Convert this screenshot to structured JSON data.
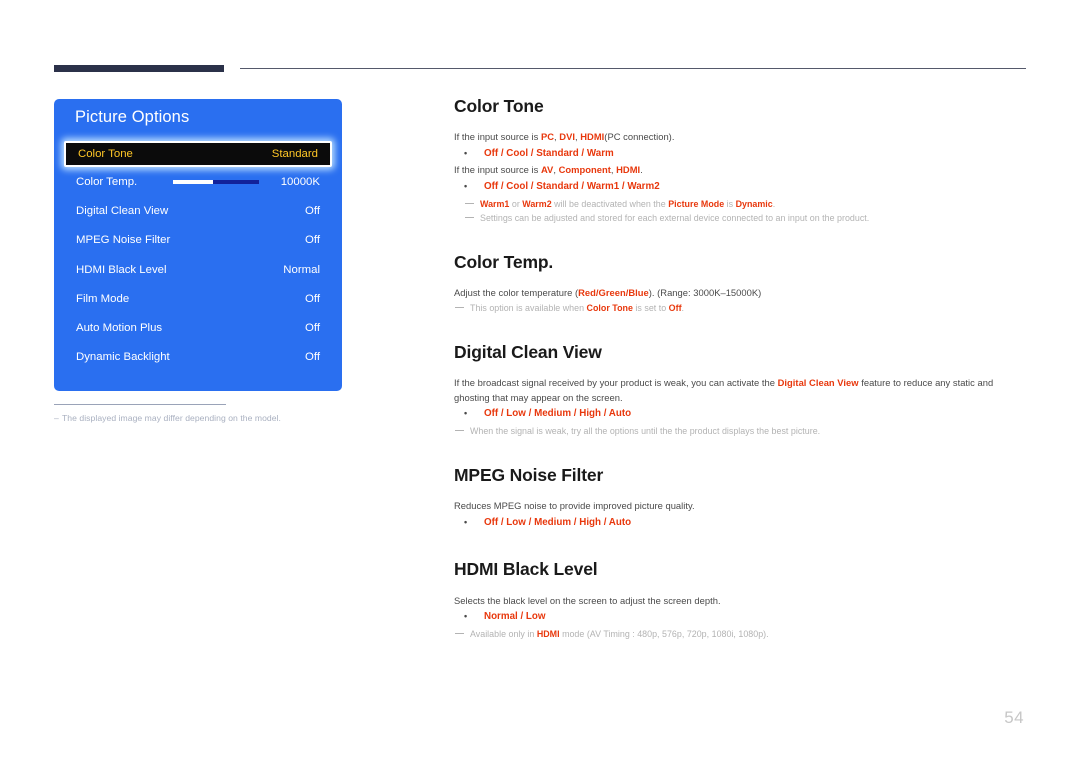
{
  "page": {
    "number": "54"
  },
  "osd": {
    "title": "Picture Options",
    "rows": [
      {
        "label": "Color Tone",
        "value": "Standard",
        "selected": true,
        "slider": false
      },
      {
        "label": "Color Temp.",
        "value": "10000K",
        "selected": false,
        "slider": true
      },
      {
        "label": "Digital Clean View",
        "value": "Off",
        "selected": false,
        "slider": false
      },
      {
        "label": "MPEG Noise Filter",
        "value": "Off",
        "selected": false,
        "slider": false
      },
      {
        "label": "HDMI Black Level",
        "value": "Normal",
        "selected": false,
        "slider": false
      },
      {
        "label": "Film Mode",
        "value": "Off",
        "selected": false,
        "slider": false
      },
      {
        "label": "Auto Motion Plus",
        "value": "Off",
        "selected": false,
        "slider": false
      },
      {
        "label": "Dynamic Backlight",
        "value": "Off",
        "selected": false,
        "slider": false
      }
    ],
    "slider_fill_percent": 47,
    "note": "The displayed image may differ depending on the model."
  },
  "sections": {
    "color_tone": {
      "title": "Color Tone",
      "line1_pre": "If the input source is ",
      "line1_pc": "PC",
      "line1_dvi": "DVI",
      "line1_hdmi": "HDMI",
      "line1_post": "(PC connection).",
      "options_pc": "Off / Cool / Standard / Warm",
      "line2_pre": "If the input source is ",
      "line2_av": "AV",
      "line2_component": "Component",
      "line2_hdmi": "HDMI",
      "line2_post": ".",
      "options_av": "Off / Cool / Standard / Warm1 / Warm2",
      "note1_a": "Warm1",
      "note1_b": " or ",
      "note1_c": "Warm2",
      "note1_d": " will be deactivated when the ",
      "note1_e": "Picture Mode",
      "note1_f": " is ",
      "note1_g": "Dynamic",
      "note1_h": ".",
      "note2": "Settings can be adjusted and stored for each external device connected to an input on the product."
    },
    "color_temp": {
      "title": "Color Temp.",
      "body_pre": "Adjust the color temperature (",
      "body_red": "Red",
      "body_green": "Green",
      "body_blue": "Blue",
      "body_post": "). (Range: 3000K–15000K)",
      "note_pre": "This option is available when ",
      "note_em1": "Color Tone",
      "note_mid": " is set to ",
      "note_em2": "Off",
      "note_post": "."
    },
    "digital_clean_view": {
      "title": "Digital Clean View",
      "body_pre": "If the broadcast signal received by your product is weak, you can activate the ",
      "body_em": "Digital Clean View",
      "body_post": " feature to reduce any static and ghosting that may appear on the screen.",
      "options": "Off / Low / Medium / High / Auto",
      "note": "When the signal is weak, try all the options until the the product displays the best picture."
    },
    "mpeg_noise_filter": {
      "title": "MPEG Noise Filter",
      "body": "Reduces MPEG noise to provide improved picture quality.",
      "options": "Off / Low / Medium / High / Auto"
    },
    "hdmi_black_level": {
      "title": "HDMI Black Level",
      "body": "Selects the black level on the screen to adjust the screen depth.",
      "options": "Normal / Low",
      "note_pre": "Available only in ",
      "note_em": "HDMI",
      "note_post": " mode (AV Timing : 480p, 576p, 720p, 1080i, 1080p)."
    }
  },
  "colors": {
    "osd_blue": "#2a6ff0",
    "accent_red": "#e8380d",
    "selected_text": "#ffc726",
    "header_bar": "#2b3149"
  }
}
